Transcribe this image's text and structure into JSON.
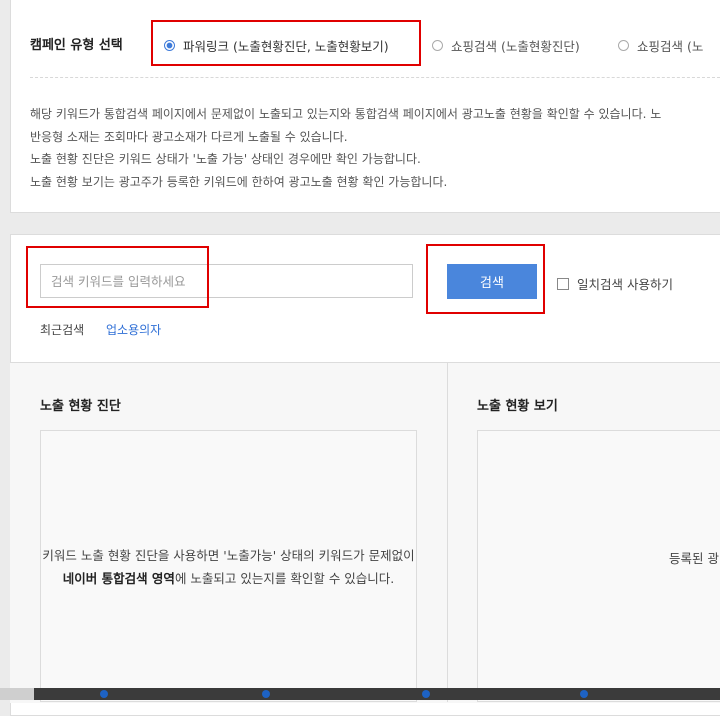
{
  "campaign": {
    "type_label": "캠페인 유형 선택",
    "options": [
      {
        "label": "파워링크 (노출현황진단, 노출현황보기)",
        "selected": true
      },
      {
        "label": "쇼핑검색 (노출현황진단)",
        "selected": false
      },
      {
        "label": "쇼핑검색 (노",
        "selected": false
      }
    ]
  },
  "description": {
    "lines": [
      "해당 키워드가 통합검색 페이지에서 문제없이 노출되고 있는지와 통합검색 페이지에서 광고노출 현황을 확인할 수 있습니다. 노",
      "반응형 소재는 조회마다 광고소재가 다르게 노출될 수 있습니다.",
      "노출 현황 진단은 키워드 상태가 '노출 가능' 상태인 경우에만 확인 가능합니다.",
      "노출 현황 보기는 광고주가 등록한 키워드에 한하여 광고노출 현황 확인 가능합니다."
    ]
  },
  "search": {
    "placeholder": "검색 키워드를 입력하세요",
    "value": "",
    "button_label": "검색",
    "exact_match_label": "일치검색 사용하기",
    "exact_match_checked": false,
    "recent_label": "최근검색",
    "recent_keyword": "업소용의자"
  },
  "panels": {
    "diagnosis": {
      "title": "노출 현황 진단",
      "text_before": "키워드 노출 현황 진단을 사용하면 '노출가능' 상태의 키워드가 문제없이 ",
      "text_bold": "네이버 통합검색 영역",
      "text_after": "에 노출되고 있는지를 확인할 수 있습니다."
    },
    "view": {
      "title": "노출 현황 보기",
      "text": "등록된 광"
    }
  },
  "colors": {
    "accent": "#4a86dc",
    "link": "#2f6fd6",
    "highlight_box": "#e00000"
  }
}
